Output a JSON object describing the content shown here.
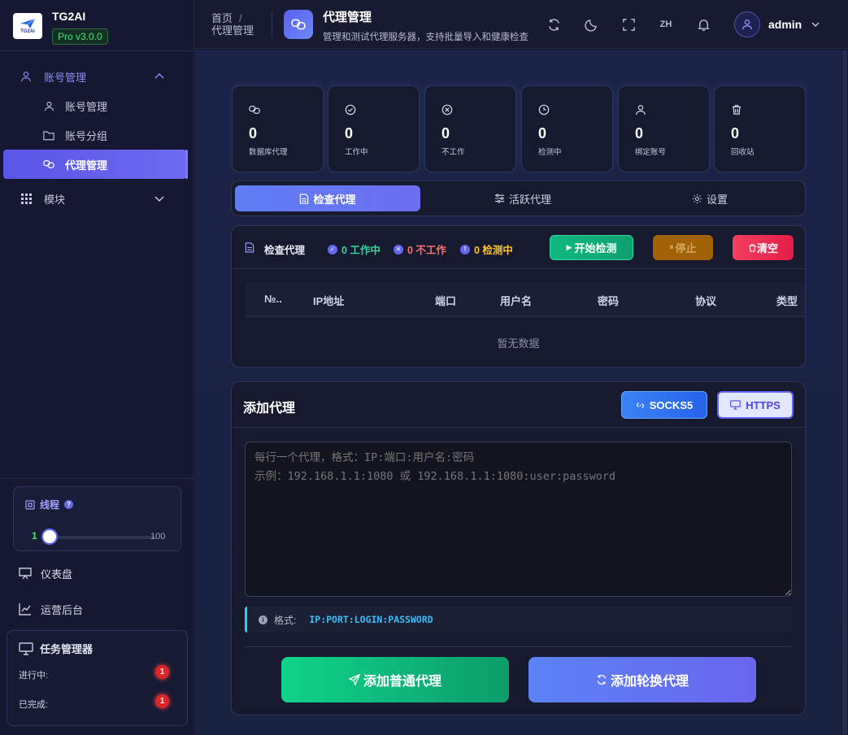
{
  "brand": {
    "name": "TG2AI",
    "logo_text": "TG2Ai",
    "version": "Pro v3.0.0"
  },
  "sidebar": {
    "items": [
      {
        "label": "账号管理",
        "icon": "user-icon"
      },
      {
        "label": "账号管理",
        "icon": "user-icon"
      },
      {
        "label": "账号分组",
        "icon": "folder-icon"
      },
      {
        "label": "代理管理",
        "icon": "link-icon"
      },
      {
        "label": "模块",
        "icon": "grid-icon"
      }
    ],
    "thread": {
      "label": "线程",
      "min": "1",
      "max": "100",
      "value": 1
    },
    "links": [
      {
        "label": "仪表盘",
        "icon": "presentation-icon"
      },
      {
        "label": "运营后台",
        "icon": "chart-icon"
      }
    ],
    "tasks": {
      "title": "任务管理器",
      "running_label": "进行中:",
      "running_count": "1",
      "done_label": "已完成:",
      "done_count": "1"
    }
  },
  "header": {
    "breadcrumb_home": "首页",
    "breadcrumb_sep": "/",
    "breadcrumb_current": "代理管理",
    "title": "代理管理",
    "subtitle": "管理和测试代理服务器，支持批量导入和健康检查",
    "lang": "ZH",
    "user": "admin"
  },
  "stats": [
    {
      "value": "0",
      "label": "数据库代理",
      "icon": "link-icon"
    },
    {
      "value": "0",
      "label": "工作中",
      "icon": "check-circle-icon"
    },
    {
      "value": "0",
      "label": "不工作",
      "icon": "x-circle-icon"
    },
    {
      "value": "0",
      "label": "检测中",
      "icon": "clock-icon"
    },
    {
      "value": "0",
      "label": "绑定账号",
      "icon": "user-icon"
    },
    {
      "value": "0",
      "label": "回收站",
      "icon": "trash-icon"
    }
  ],
  "tabs": [
    {
      "label": "检查代理"
    },
    {
      "label": "活跃代理"
    },
    {
      "label": "设置"
    }
  ],
  "check": {
    "title": "检查代理",
    "working": "0 工作中",
    "not_working": "0 不工作",
    "checking": "0 检测中",
    "start": "开始检测",
    "stop": "停止",
    "clear": "清空",
    "columns": [
      "№..",
      "IP地址",
      "端口",
      "用户名",
      "密码",
      "协议",
      "类型"
    ],
    "empty": "暂无数据"
  },
  "add": {
    "title": "添加代理",
    "socks5": "SOCKS5",
    "https": "HTTPS",
    "placeholder": "每行一个代理，格式：IP:端口:用户名:密码\n示例：192.168.1.1:1080 或 192.168.1.1:1080:user:password",
    "format_label": "格式:",
    "format_value": "IP:PORT:LOGIN:PASSWORD",
    "add_normal": "添加普通代理",
    "add_rotating": "添加轮换代理"
  },
  "colors": {
    "accent": "#6366f1",
    "green": "#10b981",
    "red": "#f43f5e",
    "amber": "#b7791f",
    "working": "#34d399",
    "not_working": "#f87171",
    "checking": "#fbbf24"
  }
}
